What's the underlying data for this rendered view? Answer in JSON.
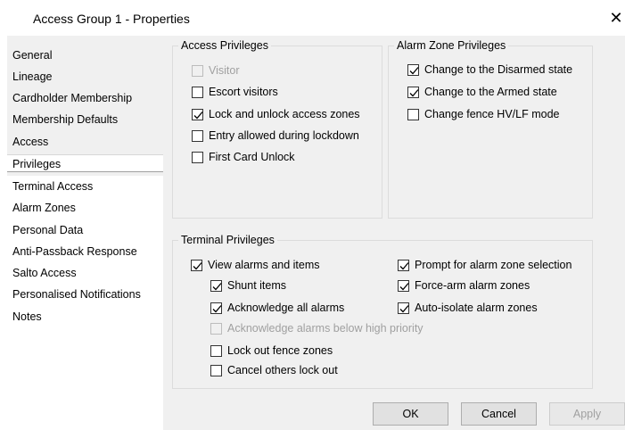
{
  "window": {
    "title": "Access Group 1 - Properties",
    "close_glyph": "✕"
  },
  "nav": {
    "items": [
      {
        "label": "General"
      },
      {
        "label": "Lineage"
      },
      {
        "label": "Cardholder Membership"
      },
      {
        "label": "Membership Defaults"
      },
      {
        "label": "Access"
      },
      {
        "label": "Privileges",
        "selected": true
      },
      {
        "label": "Terminal Access"
      },
      {
        "label": "Alarm Zones"
      },
      {
        "label": "Personal Data"
      },
      {
        "label": "Anti-Passback Response"
      },
      {
        "label": "Salto Access"
      },
      {
        "label": "Personalised Notifications"
      },
      {
        "label": "Notes"
      }
    ]
  },
  "access_privileges": {
    "title": "Access Privileges",
    "items": [
      {
        "label": "Visitor",
        "checked": false,
        "enabled": false
      },
      {
        "label": "Escort visitors",
        "checked": false,
        "enabled": true
      },
      {
        "label": "Lock and unlock access zones",
        "checked": true,
        "enabled": true
      },
      {
        "label": "Entry allowed during lockdown",
        "checked": false,
        "enabled": true
      },
      {
        "label": "First Card Unlock",
        "checked": false,
        "enabled": true
      }
    ]
  },
  "alarm_zone_privileges": {
    "title": "Alarm Zone Privileges",
    "items": [
      {
        "label": "Change to the Disarmed state",
        "checked": true,
        "enabled": true
      },
      {
        "label": "Change to the Armed state",
        "checked": true,
        "enabled": true
      },
      {
        "label": "Change fence HV/LF mode",
        "checked": false,
        "enabled": true
      }
    ]
  },
  "terminal_privileges": {
    "title": "Terminal Privileges",
    "left_items": [
      {
        "label": "View alarms and items",
        "checked": true,
        "enabled": true
      },
      {
        "label": "Shunt items",
        "checked": true,
        "enabled": true
      },
      {
        "label": "Acknowledge all alarms",
        "checked": true,
        "enabled": true
      },
      {
        "label": "Acknowledge alarms below high priority",
        "checked": false,
        "enabled": false
      },
      {
        "label": "Lock out fence zones",
        "checked": false,
        "enabled": true
      },
      {
        "label": "Cancel others lock out",
        "checked": false,
        "enabled": true
      }
    ],
    "right_items": [
      {
        "label": "Prompt for alarm zone selection",
        "checked": true,
        "enabled": true
      },
      {
        "label": "Force-arm alarm zones",
        "checked": true,
        "enabled": true
      },
      {
        "label": "Auto-isolate alarm zones",
        "checked": true,
        "enabled": true
      }
    ]
  },
  "buttons": {
    "ok": "OK",
    "cancel": "Cancel",
    "apply": "Apply"
  }
}
